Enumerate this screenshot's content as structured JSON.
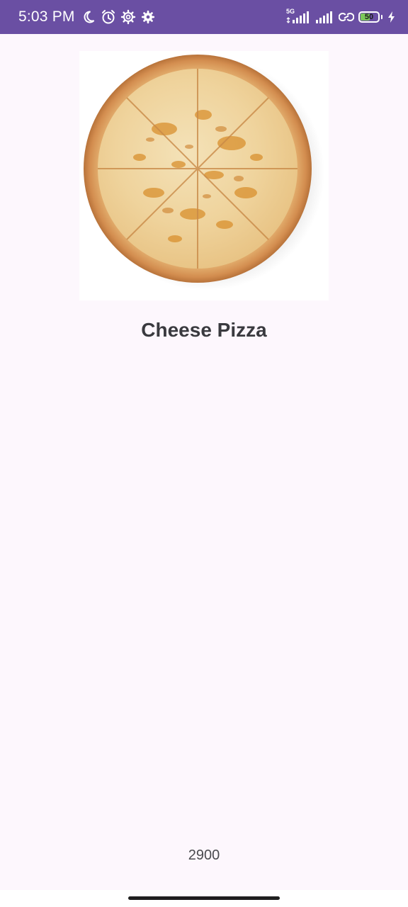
{
  "status_bar": {
    "time": "5:03 PM",
    "network_label": "5G",
    "battery_level": "50",
    "icons": [
      "moon-icon",
      "alarm-icon",
      "gear-outline-icon",
      "gear-icon",
      "signal-icon",
      "signal-icon",
      "link-icon",
      "battery-icon",
      "charging-bolt-icon"
    ],
    "background_color": "#6a4fa3"
  },
  "product": {
    "image_name": "cheese-pizza",
    "title": "Cheese Pizza",
    "price": "2900"
  },
  "colors": {
    "page_background": "#fdf7fd",
    "title_color": "#3a3a3f"
  }
}
